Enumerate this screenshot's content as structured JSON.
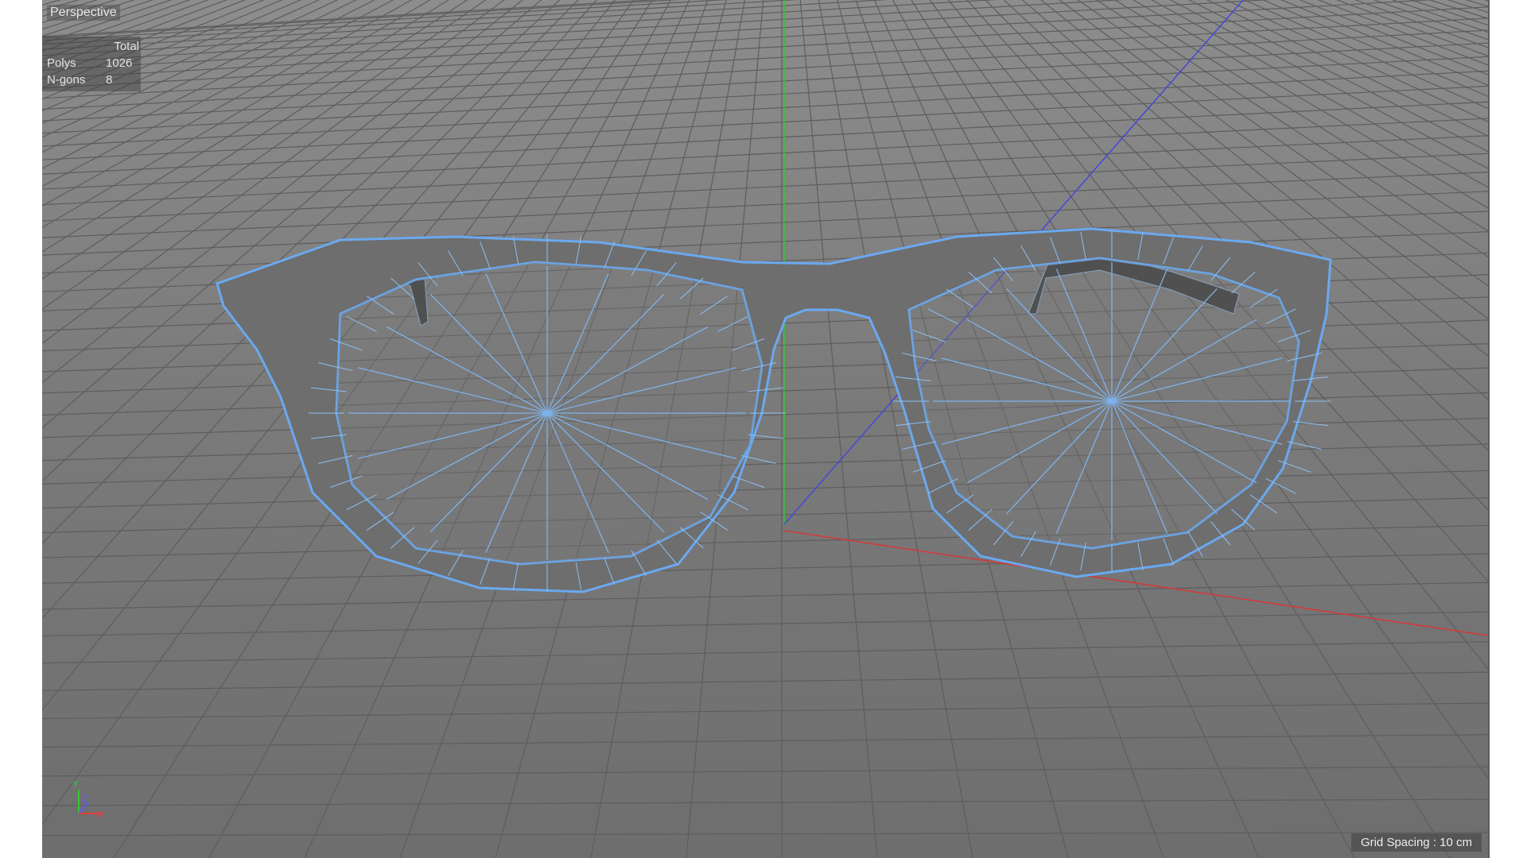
{
  "viewport": {
    "name": "Perspective",
    "stats": {
      "header": "Total",
      "rows": [
        {
          "label": "Polys",
          "value": "1026"
        },
        {
          "label": "N-gons",
          "value": "8"
        }
      ]
    },
    "grid_spacing": "Grid Spacing : 10 cm"
  },
  "axes": {
    "y": "Y",
    "z": "Z",
    "x": "X"
  },
  "colors": {
    "viewport_bg": "#7d7d7d",
    "grid_line": "#5f5f5f",
    "axis_x": "#d43a3a",
    "axis_y": "#3cbf3c",
    "axis_z": "#4a4ad6",
    "model_fill": "#707070",
    "wireframe": "#7fb2ea",
    "outline": "#6aa9f0"
  },
  "icons": [
    "axis-gizmo-icon"
  ]
}
